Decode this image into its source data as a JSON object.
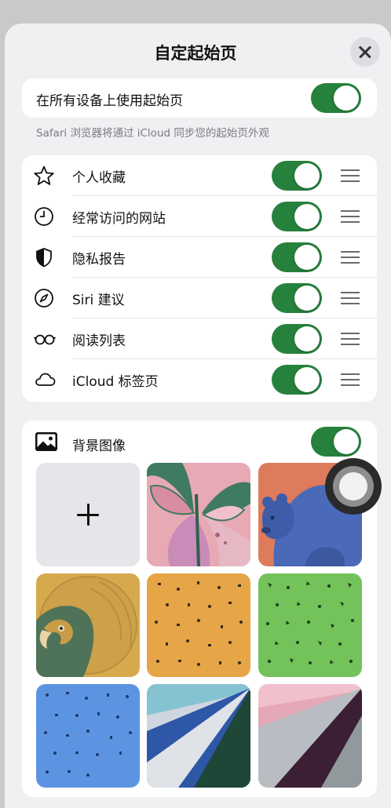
{
  "header": {
    "title": "自定起始页",
    "close_icon": "close-icon"
  },
  "sync": {
    "label": "在所有设备上使用起始页",
    "enabled": true,
    "note": "Safari 浏览器将通过 iCloud 同步您的起始页外观"
  },
  "sections": [
    {
      "label": "个人收藏",
      "icon": "star-icon",
      "enabled": true
    },
    {
      "label": "经常访问的网站",
      "icon": "clock-icon",
      "enabled": true
    },
    {
      "label": "隐私报告",
      "icon": "shield-icon",
      "enabled": true
    },
    {
      "label": "Siri 建议",
      "icon": "compass-icon",
      "enabled": true
    },
    {
      "label": "阅读列表",
      "icon": "glasses-icon",
      "enabled": true
    },
    {
      "label": "iCloud 标签页",
      "icon": "cloud-icon",
      "enabled": true
    }
  ],
  "background": {
    "label": "背景图像",
    "icon": "photo-icon",
    "enabled": true,
    "tiles": [
      "add",
      "butterfly",
      "bear",
      "parrot",
      "orange-pattern",
      "green-pattern",
      "blue-pattern",
      "blue-geometric",
      "purple-geometric"
    ]
  },
  "colors": {
    "accent": "#26813c",
    "sheet": "#f0f0f3",
    "card": "#ffffff"
  }
}
